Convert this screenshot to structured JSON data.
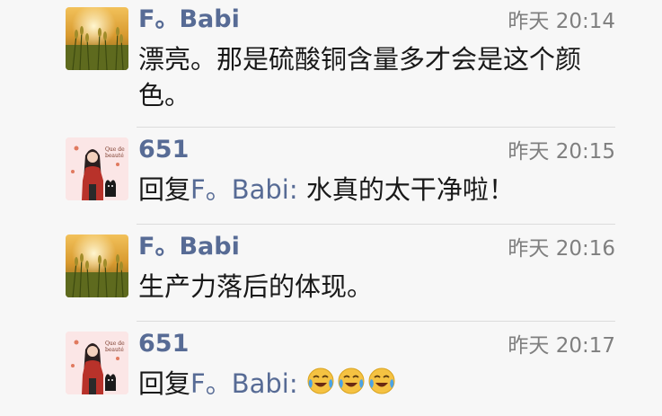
{
  "comments": [
    {
      "name": "F。Babi",
      "time": "昨天 20:14",
      "text": "漂亮。那是硫酸铜含量多才会是这个颜色。",
      "avatar_icon": "wheat-field-sunset-avatar"
    },
    {
      "name": "651",
      "time": "昨天 20:15",
      "reply_prefix": "回复",
      "reply_to": "F。Babi",
      "reply_sep": ": ",
      "text": "水真的太干净啦！",
      "avatar_icon": "girl-with-cat-illustration-avatar",
      "avatar_caption": "Que de beauté"
    },
    {
      "name": "F。Babi",
      "time": "昨天 20:16",
      "text": "生产力落后的体现。",
      "avatar_icon": "wheat-field-sunset-avatar"
    },
    {
      "name": "651",
      "time": "昨天 20:17",
      "reply_prefix": "回复",
      "reply_to": "F。Babi",
      "reply_sep": ": ",
      "emojis": [
        "crying-laughing-emoji",
        "crying-laughing-emoji",
        "crying-laughing-emoji"
      ],
      "avatar_icon": "girl-with-cat-illustration-avatar",
      "avatar_caption": "Que de beauté"
    }
  ],
  "colors": {
    "name": "#576b95",
    "time": "#7f7f7f",
    "text": "#191919",
    "background": "#f7f7f7",
    "divider": "#dcdcdc"
  }
}
